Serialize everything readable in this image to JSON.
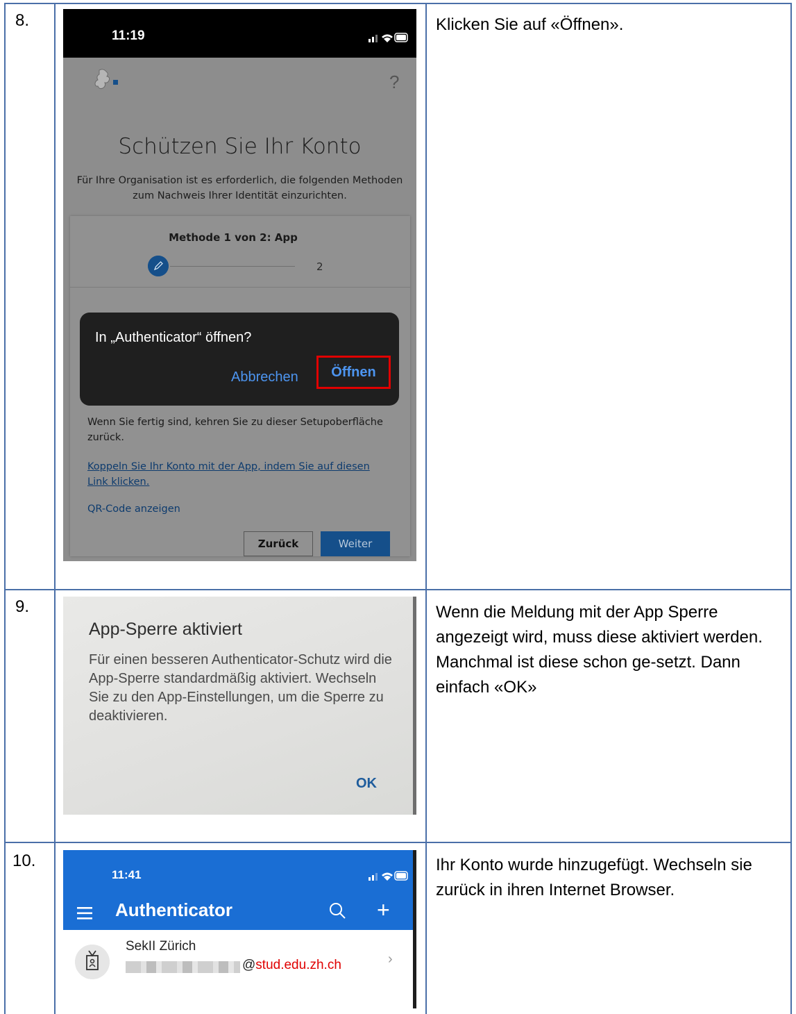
{
  "rows": [
    {
      "number": "8.",
      "description": "Klicken Sie auf «Öffnen».",
      "screenshot": {
        "time": "11:19",
        "help": "?",
        "title": "Schützen Sie Ihr Konto",
        "intro": "Für Ihre Organisation ist es erforderlich, die folgenden Methoden zum Nachweis Ihrer Identität einzurichten.",
        "method": "Methode 1 von 2: App",
        "step2": "2",
        "dialog_title": "In „Authenticator“ öffnen?",
        "dialog_cancel": "Abbrechen",
        "dialog_open": "Öffnen",
        "after_text": "Wenn Sie fertig sind, kehren Sie zu dieser Setupoberfläche zurück.",
        "link": "Koppeln Sie Ihr Konto mit der App, indem Sie auf diesen Link klicken.",
        "qr": "QR-Code anzeigen",
        "back": "Zurück",
        "next": "Weiter"
      }
    },
    {
      "number": "9.",
      "description": "Wenn die Meldung mit der App Sperre angezeigt wird, muss diese aktiviert werden. Manchmal ist diese schon ge-setzt. Dann einfach «OK»",
      "screenshot": {
        "heading": "App-Sperre aktiviert",
        "body": "Für einen besseren Authenticator-Schutz wird die App-Sperre standardmäßig aktiviert. Wechseln Sie zu den App-Einstellungen, um die Sperre zu deaktivieren.",
        "ok": "OK"
      }
    },
    {
      "number": "10.",
      "description": "Ihr Konto wurde hinzugefügt. Wechseln sie zurück in ihren Internet Browser.",
      "screenshot": {
        "time": "11:41",
        "app_title": "Authenticator",
        "account_name": "SekII Zürich",
        "email_at": "@",
        "email_domain": "stud.edu.zh.ch"
      }
    }
  ],
  "colors": {
    "grid": "#4a6fa8",
    "highlight": "#e00000",
    "ms_blue": "#1a6ed4"
  }
}
